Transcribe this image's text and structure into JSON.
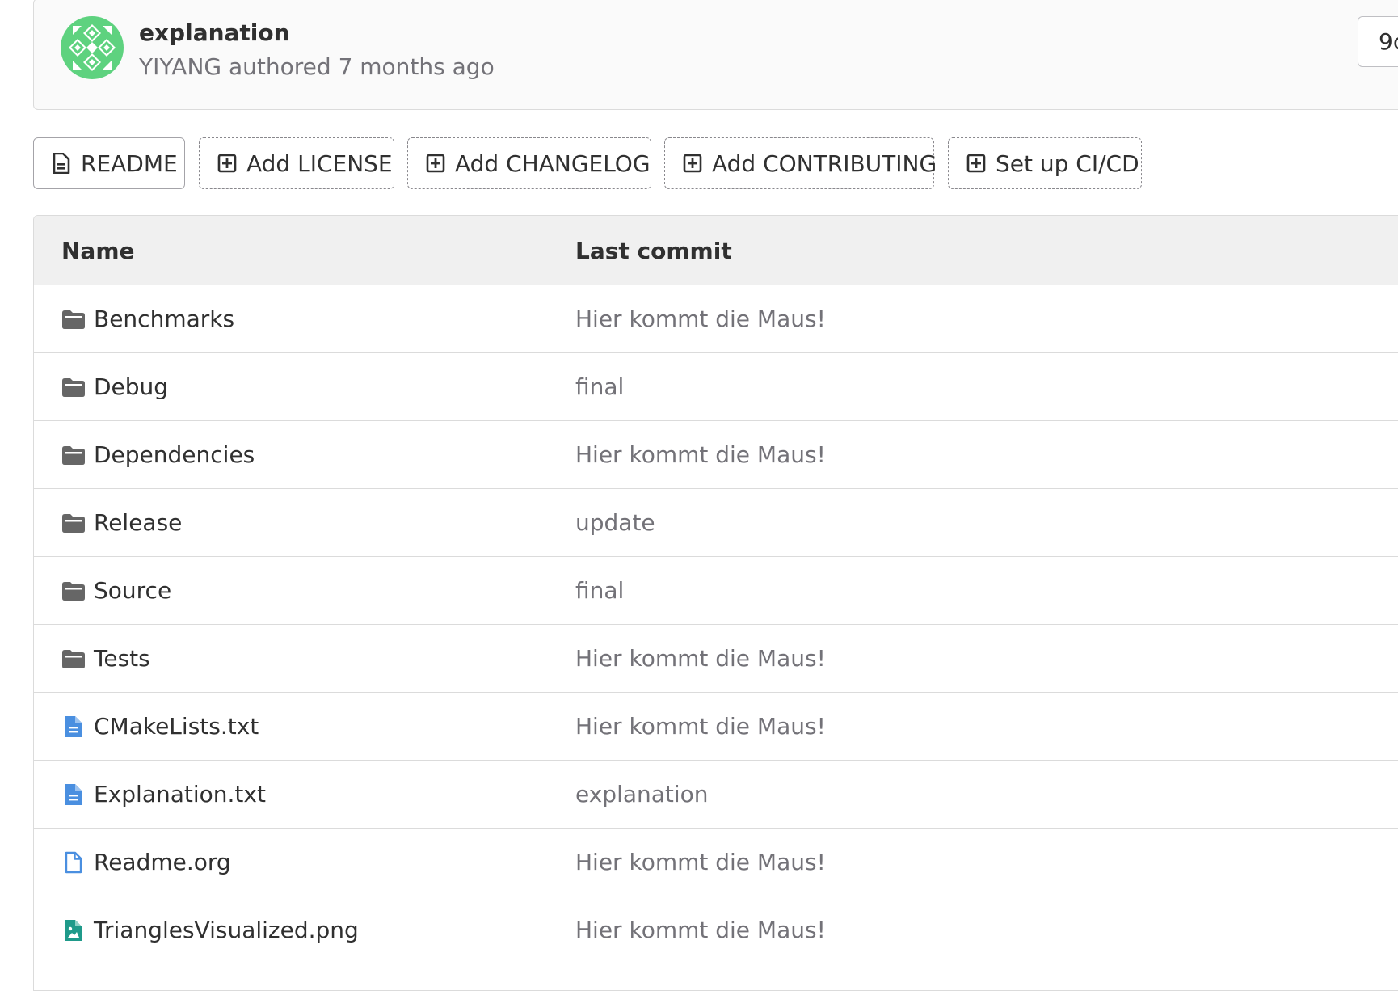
{
  "commit": {
    "title": "explanation",
    "author": "YIYANG",
    "authored_text": "authored",
    "time": "7 months ago",
    "sha_partial": "9c"
  },
  "actions": [
    {
      "label": "README",
      "icon": "file-icon",
      "style": "solid"
    },
    {
      "label": "Add LICENSE",
      "icon": "plus-square-icon",
      "style": "dashed"
    },
    {
      "label": "Add CHANGELOG",
      "icon": "plus-square-icon",
      "style": "dashed"
    },
    {
      "label": "Add CONTRIBUTING",
      "icon": "plus-square-icon",
      "style": "dashed"
    },
    {
      "label": "Set up CI/CD",
      "icon": "plus-square-icon",
      "style": "dashed"
    }
  ],
  "table": {
    "columns": [
      "Name",
      "Last commit"
    ],
    "rows": [
      {
        "name": "Benchmarks",
        "type": "folder",
        "icon": "folder-icon",
        "commit": "Hier kommt die Maus!"
      },
      {
        "name": "Debug",
        "type": "folder",
        "icon": "folder-icon",
        "commit": "final"
      },
      {
        "name": "Dependencies",
        "type": "folder",
        "icon": "folder-icon",
        "commit": "Hier kommt die Maus!"
      },
      {
        "name": "Release",
        "type": "folder",
        "icon": "folder-icon",
        "commit": "update"
      },
      {
        "name": "Source",
        "type": "folder",
        "icon": "folder-icon",
        "commit": "final"
      },
      {
        "name": "Tests",
        "type": "folder",
        "icon": "folder-icon",
        "commit": "Hier kommt die Maus!"
      },
      {
        "name": "CMakeLists.txt",
        "type": "text",
        "icon": "text-file-icon",
        "commit": "Hier kommt die Maus!"
      },
      {
        "name": "Explanation.txt",
        "type": "text",
        "icon": "text-file-icon",
        "commit": "explanation"
      },
      {
        "name": "Readme.org",
        "type": "blank",
        "icon": "file-outline-icon",
        "commit": "Hier kommt die Maus!"
      },
      {
        "name": "TrianglesVisualized.png",
        "type": "image",
        "icon": "image-file-icon",
        "commit": "Hier kommt die Maus!"
      }
    ]
  },
  "colors": {
    "avatar_green": "#5ed27f",
    "folder_gray": "#666666",
    "text_file_blue": "#4a8fe0",
    "image_file_teal": "#1f9a8a"
  }
}
